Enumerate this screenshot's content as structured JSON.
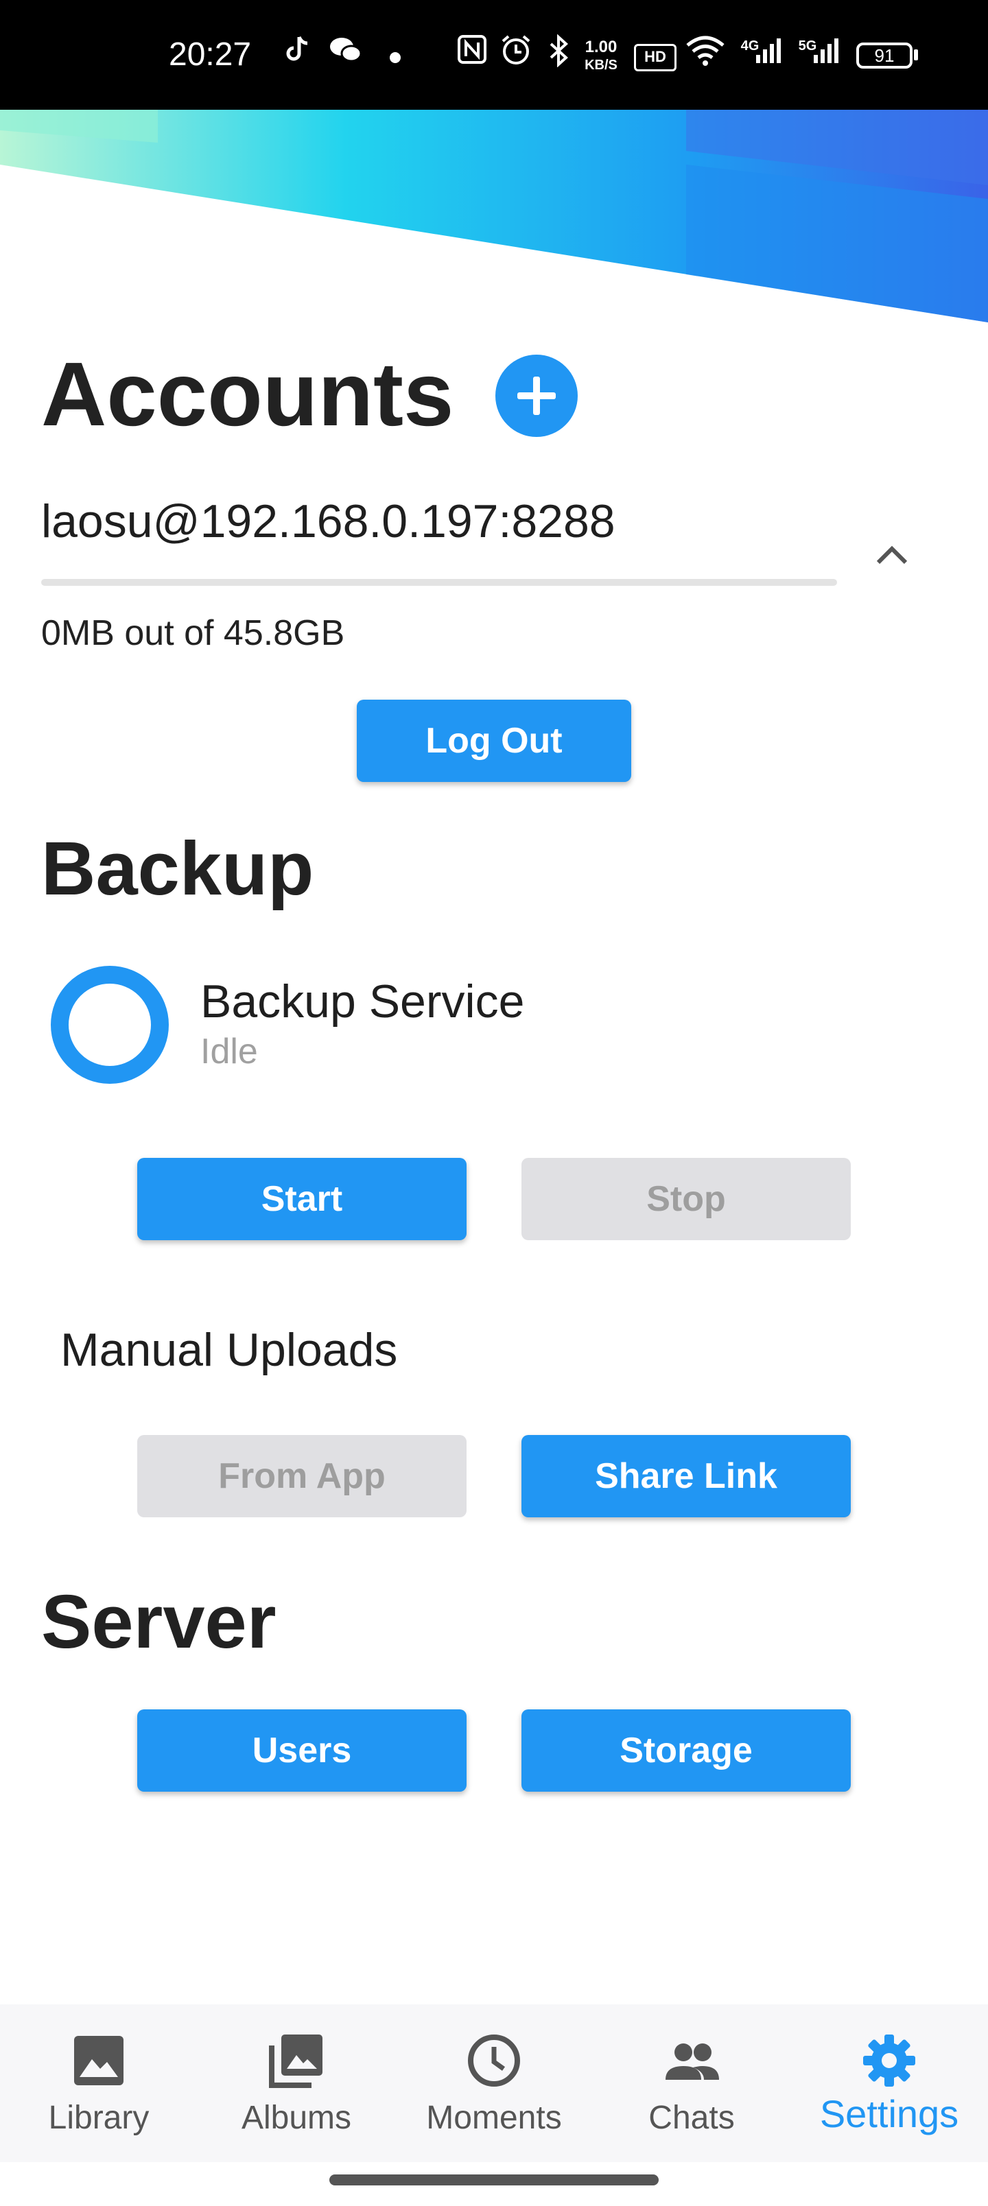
{
  "status_bar": {
    "time": "20:27",
    "speed_value": "1.00",
    "speed_unit": "KB/S",
    "hd_badge": "HD",
    "net_4g": "4G",
    "net_5g": "5G",
    "battery": "91"
  },
  "accounts": {
    "title": "Accounts",
    "selected_account": "laosu@192.168.0.197:8288",
    "storage": "0MB out of 45.8GB",
    "logout_label": "Log Out"
  },
  "backup": {
    "title": "Backup",
    "service_name": "Backup Service",
    "service_status": "Idle",
    "start_label": "Start",
    "stop_label": "Stop",
    "manual_title": "Manual Uploads",
    "from_app_label": "From App",
    "share_link_label": "Share Link"
  },
  "server": {
    "title": "Server",
    "users_label": "Users",
    "storage_label": "Storage"
  },
  "nav": {
    "items": [
      {
        "label": "Library",
        "icon": "image-icon"
      },
      {
        "label": "Albums",
        "icon": "albums-icon"
      },
      {
        "label": "Moments",
        "icon": "clock-icon"
      },
      {
        "label": "Chats",
        "icon": "people-icon"
      },
      {
        "label": "Settings",
        "icon": "gear-icon",
        "active": true
      }
    ]
  },
  "colors": {
    "accent": "#2196f3",
    "disabled_bg": "#e0e0e3",
    "disabled_text": "#9e9e9e"
  }
}
